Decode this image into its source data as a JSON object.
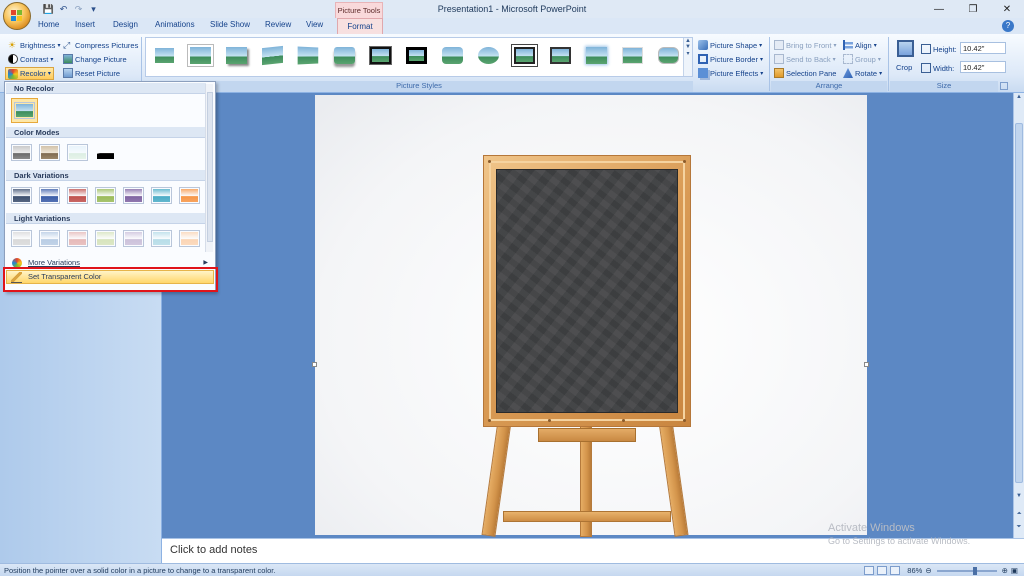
{
  "window": {
    "title": "Presentation1 - Microsoft PowerPoint",
    "context_tab_title": "Picture Tools"
  },
  "quick_access": {
    "icons": [
      "save-icon",
      "undo-icon",
      "redo-icon",
      "customize-icon"
    ]
  },
  "tabs": [
    {
      "label": "Home"
    },
    {
      "label": "Insert"
    },
    {
      "label": "Design"
    },
    {
      "label": "Animations"
    },
    {
      "label": "Slide Show"
    },
    {
      "label": "Review"
    },
    {
      "label": "View"
    },
    {
      "label": "Format",
      "active": true
    }
  ],
  "ribbon": {
    "adjust": {
      "brightness": "Brightness",
      "contrast": "Contrast",
      "recolor": "Recolor",
      "compress": "Compress Pictures",
      "change": "Change Picture",
      "reset": "Reset Picture"
    },
    "picture_styles": {
      "label": "Picture Styles",
      "shape": "Picture Shape",
      "border": "Picture Border",
      "effects": "Picture Effects"
    },
    "arrange": {
      "label": "Arrange",
      "bring_front": "Bring to Front",
      "send_back": "Send to Back",
      "selection_pane": "Selection Pane",
      "align": "Align",
      "group": "Group",
      "rotate": "Rotate"
    },
    "size": {
      "label": "Size",
      "crop": "Crop",
      "height_label": "Height:",
      "height_value": "10.42\"",
      "width_label": "Width:",
      "width_value": "10.42\""
    }
  },
  "recolor_menu": {
    "no_recolor": "No Recolor",
    "color_modes": "Color Modes",
    "dark_variations": "Dark Variations",
    "light_variations": "Light Variations",
    "more_variations": "More Variations",
    "set_transparent": "Set Transparent Color",
    "dark_colors": [
      "#3d4f6e",
      "#3b5da8",
      "#c0504d",
      "#9bbb59",
      "#8064a2",
      "#4bacc6",
      "#f79646"
    ],
    "light_colors": [
      "#d9d9d9",
      "#b8cce4",
      "#e6b9b8",
      "#d7e4bd",
      "#ccc1da",
      "#b7dde8",
      "#fbd5b5"
    ]
  },
  "notes": {
    "placeholder": "Click to add notes"
  },
  "watermark": {
    "line1": "Activate Windows",
    "line2": "Go to Settings to activate Windows."
  },
  "status": {
    "message": "Position the pointer over a solid color in a picture to change to a transparent color.",
    "zoom": "86%"
  },
  "colors": {
    "accent_red_box": "#e0141a",
    "ribbon_blue": "#15428b",
    "board": "#414244",
    "wood": "#d99b55"
  }
}
